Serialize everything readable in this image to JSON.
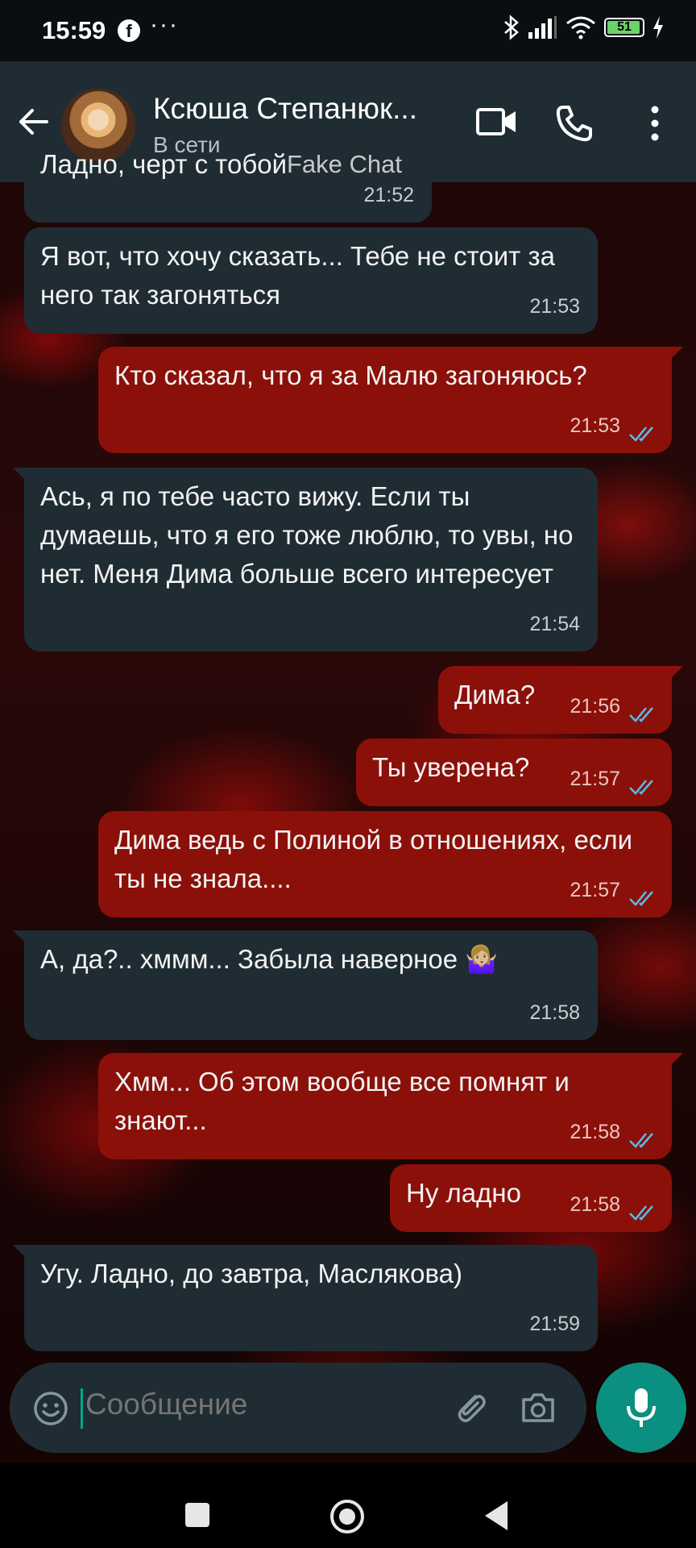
{
  "status_bar": {
    "time": "15:59",
    "dots": "···",
    "battery": "51"
  },
  "header": {
    "contact_name": "Ксюша Степанюк...",
    "contact_status": "В сети",
    "overlay_text": "Fake Chat"
  },
  "messages": [
    {
      "dir": "in",
      "text": "Ладно, черт с тобой",
      "time": "21:52"
    },
    {
      "dir": "in",
      "text": "Я вот, что хочу сказать... Тебе не стоит за него так загоняться",
      "time": "21:53"
    },
    {
      "dir": "out",
      "text": "Кто сказал, что я за Малю загоняюсь?",
      "time": "21:53"
    },
    {
      "dir": "in",
      "text": "Ась, я по тебе часто вижу. Если ты думаешь, что я его тоже люблю, то увы, но нет. Меня Дима больше всего интересует",
      "time": "21:54"
    },
    {
      "dir": "out",
      "text": "Дима?",
      "time": "21:56"
    },
    {
      "dir": "out",
      "text": "Ты уверена?",
      "time": "21:57"
    },
    {
      "dir": "out",
      "text": "Дима ведь с Полиной в отношениях, если ты не знала....",
      "time": "21:57"
    },
    {
      "dir": "in",
      "text": "А, да?.. хммм... Забыла наверное 🤷🏼‍♀️",
      "time": "21:58"
    },
    {
      "dir": "out",
      "text": "Хмм... Об этом вообще все помнят и знают...",
      "time": "21:58"
    },
    {
      "dir": "out",
      "text": "Ну ладно",
      "time": "21:58"
    },
    {
      "dir": "in",
      "text": "Угу. Ладно, до завтра, Маслякова)",
      "time": "21:59"
    }
  ],
  "input": {
    "placeholder": "Сообщение"
  },
  "colors": {
    "incoming_bubble": "#1f2c33",
    "outgoing_bubble": "#8b1009",
    "read_ticks": "#53bdeb",
    "mic_button": "#0b8f80",
    "cursor": "#00a884"
  },
  "icons": {
    "back": "arrow-left-icon",
    "video": "video-camera-icon",
    "call": "phone-icon",
    "menu": "more-vertical-icon",
    "emoji": "smiley-icon",
    "attach": "paperclip-icon",
    "camera": "camera-icon",
    "mic": "microphone-icon",
    "ticks": "double-check-icon"
  }
}
